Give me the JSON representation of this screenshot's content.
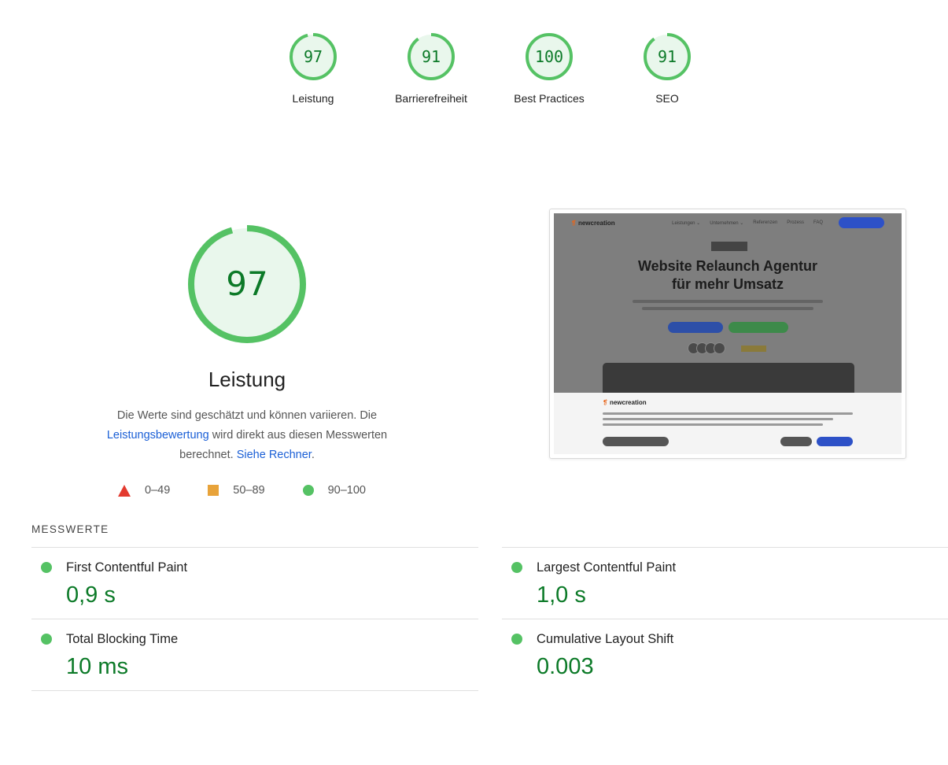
{
  "gauges": [
    {
      "score": "97",
      "label": "Leistung",
      "fill": 0.97
    },
    {
      "score": "91",
      "label": "Barrierefreiheit",
      "fill": 0.91
    },
    {
      "score": "100",
      "label": "Best Practices",
      "fill": 1.0
    },
    {
      "score": "91",
      "label": "SEO",
      "fill": 0.91
    }
  ],
  "main": {
    "score": "97",
    "fill": 0.97,
    "title": "Leistung",
    "desc_part1": "Die Werte sind geschätzt und können variieren. Die",
    "desc_link1": "Leistungsbewertung",
    "desc_part2": "wird direkt aus diesen Messwerten berechnet.",
    "desc_link2": "Siehe Rechner",
    "desc_end": "."
  },
  "legend": [
    {
      "shape": "triangle",
      "range": "0–49",
      "color": "#e33a2f"
    },
    {
      "shape": "square",
      "range": "50–89",
      "color": "#e8a33a"
    },
    {
      "shape": "circle",
      "range": "90–100",
      "color": "#55c264"
    }
  ],
  "preview": {
    "logo": "newcreation",
    "nav": [
      "Leistungen ⌄",
      "Unternehmen ⌄",
      "Referenzen",
      "Prozess",
      "FAQ"
    ],
    "headline_1": "Website Relaunch Agentur",
    "headline_2": "für mehr Umsatz",
    "cookie_logo": "newcreation"
  },
  "metrics": {
    "heading": "MESSWERTE",
    "items": [
      {
        "title": "First Contentful Paint",
        "value": "0,9 s"
      },
      {
        "title": "Largest Contentful Paint",
        "value": "1,0 s"
      },
      {
        "title": "Total Blocking Time",
        "value": "10 ms"
      },
      {
        "title": "Cumulative Layout Shift",
        "value": "0.003"
      }
    ]
  },
  "colors": {
    "pass": "#0c7a28",
    "pass_ring": "#55c264",
    "pass_bg": "#e9f7ec",
    "link": "#1a5fd6"
  }
}
